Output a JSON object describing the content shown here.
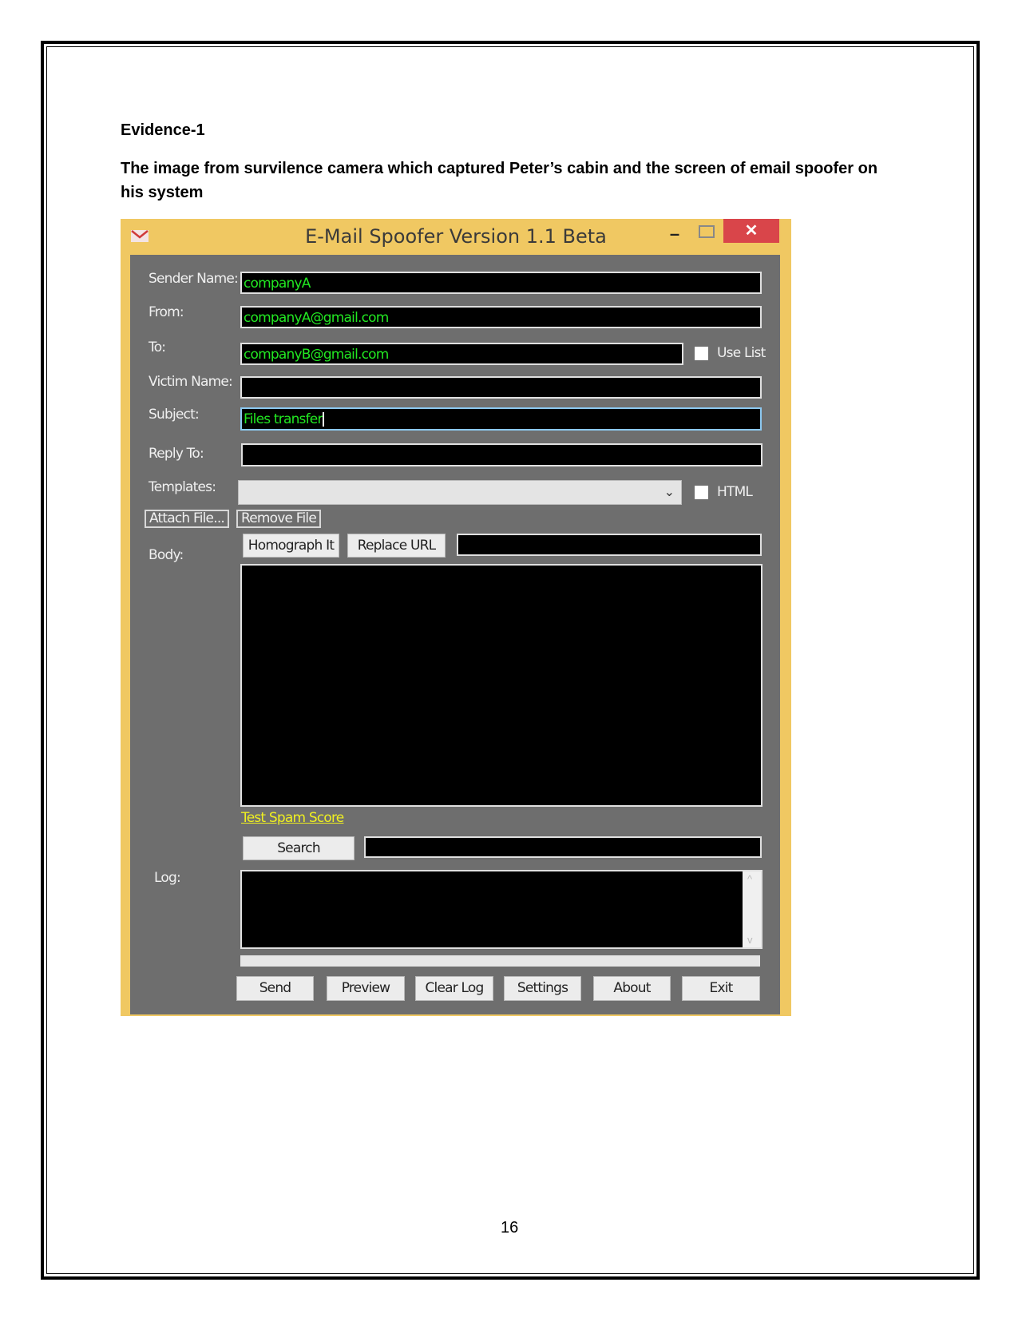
{
  "document": {
    "heading": "Evidence-1",
    "paragraph_line1": "The image from survilence camera which captured Peter’s cabin and the screen of email spoofer on",
    "paragraph_line2": "his system",
    "page_number": "16"
  },
  "window": {
    "title": "E-Mail Spoofer Version 1.1 Beta",
    "minimize": "–",
    "close": "✕",
    "colors": {
      "titlebar": "#f0c862",
      "client": "#6e6e6e",
      "field_text": "#22e822",
      "close": "#d9454a",
      "link": "#f0f020"
    }
  },
  "form": {
    "sender_name": {
      "label": "Sender Name:",
      "value": "companyA"
    },
    "from": {
      "label": "From:",
      "value": "companyA@gmail.com"
    },
    "to": {
      "label": "To:",
      "value": "companyB@gmail.com"
    },
    "use_list": {
      "label": "Use List",
      "checked": false
    },
    "victim_name": {
      "label": "Victim Name:",
      "value": ""
    },
    "subject": {
      "label": "Subject:",
      "value": "Files transfer"
    },
    "reply_to": {
      "label": "Reply To:",
      "value": ""
    },
    "templates": {
      "label": "Templates:",
      "value": ""
    },
    "html": {
      "label": "HTML",
      "checked": false
    },
    "attach_file": "Attach File...",
    "remove_file": "Remove File",
    "body": {
      "label": "Body:",
      "value": ""
    },
    "homograph": "Homograph It",
    "replace_url": "Replace URL",
    "replace_url_value": "",
    "test_spam_score": "Test Spam Score",
    "search": "Search",
    "search_value": "",
    "log": {
      "label": "Log:",
      "value": ""
    },
    "progress": 0
  },
  "buttons": {
    "send": "Send",
    "preview": "Preview",
    "clear_log": "Clear Log",
    "settings": "Settings",
    "about": "About",
    "exit": "Exit"
  }
}
